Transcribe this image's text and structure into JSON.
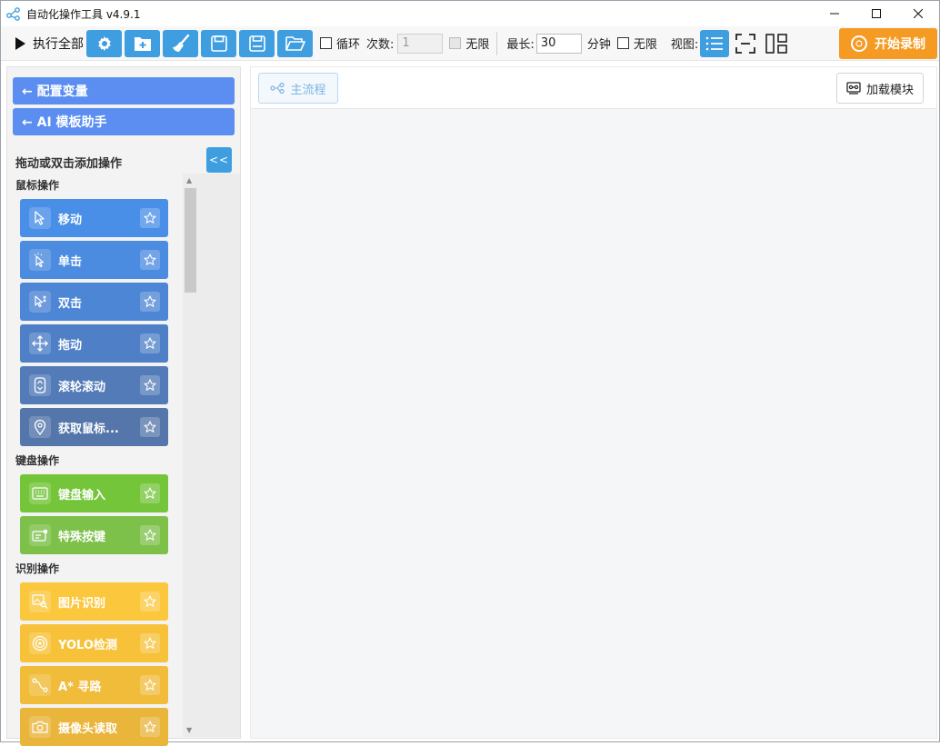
{
  "window": {
    "title": "自动化操作工具 v4.9.1",
    "minimize_icon": "minimize-icon",
    "maximize_icon": "maximize-icon",
    "close_icon": "close-icon"
  },
  "toolbar": {
    "run_all_label": "执行全部",
    "tool_buttons": [
      "gear-icon",
      "new-file-icon",
      "broom-icon",
      "save-icon",
      "save-as-icon",
      "open-folder-icon"
    ],
    "loop_label": "循环",
    "count_label": "次数:",
    "count_value": "1",
    "unlimited_label_1": "无限",
    "max_label": "最长:",
    "max_value": "30",
    "minutes_label": "分钟",
    "unlimited_label_2": "无限",
    "view_label": "视图:",
    "record_label": "开始录制",
    "accent_color": "#3f9ee0",
    "record_color": "#f59a23"
  },
  "sidebar": {
    "config_vars_label": "← 配置变量",
    "ai_helper_label": "← AI 模板助手",
    "drag_hint": "拖动或双击添加操作",
    "collapse_label": "<<",
    "categories": [
      {
        "label": "鼠标操作",
        "items": [
          {
            "label": "移动",
            "icon": "cursor-icon",
            "color": "#4a8fe7"
          },
          {
            "label": "单击",
            "icon": "cursor-click-icon",
            "color": "#4b8be0"
          },
          {
            "label": "双击",
            "icon": "cursor-double-click-icon",
            "color": "#4d86d5"
          },
          {
            "label": "拖动",
            "icon": "move-arrows-icon",
            "color": "#4f80c7"
          },
          {
            "label": "滚轮滚动",
            "icon": "scroll-wheel-icon",
            "color": "#527bb8"
          },
          {
            "label": "获取鼠标...",
            "icon": "location-pin-icon",
            "color": "#5576aa"
          }
        ]
      },
      {
        "label": "键盘操作",
        "items": [
          {
            "label": "键盘输入",
            "icon": "keyboard-icon",
            "color": "#74c53a"
          },
          {
            "label": "特殊按键",
            "icon": "special-key-icon",
            "color": "#7dc04a"
          }
        ]
      },
      {
        "label": "识别操作",
        "items": [
          {
            "label": "图片识别",
            "icon": "image-search-icon",
            "color": "#fbc73c"
          },
          {
            "label": "YOLO检测",
            "icon": "target-icon",
            "color": "#f7c23a"
          },
          {
            "label": "A* 寻路",
            "icon": "path-icon",
            "color": "#f0bc3a"
          },
          {
            "label": "摄像头读取",
            "icon": "camera-icon",
            "color": "#e9b53b"
          }
        ]
      }
    ]
  },
  "main": {
    "flow_tab_label": "主流程",
    "load_module_label": "加载模块"
  }
}
